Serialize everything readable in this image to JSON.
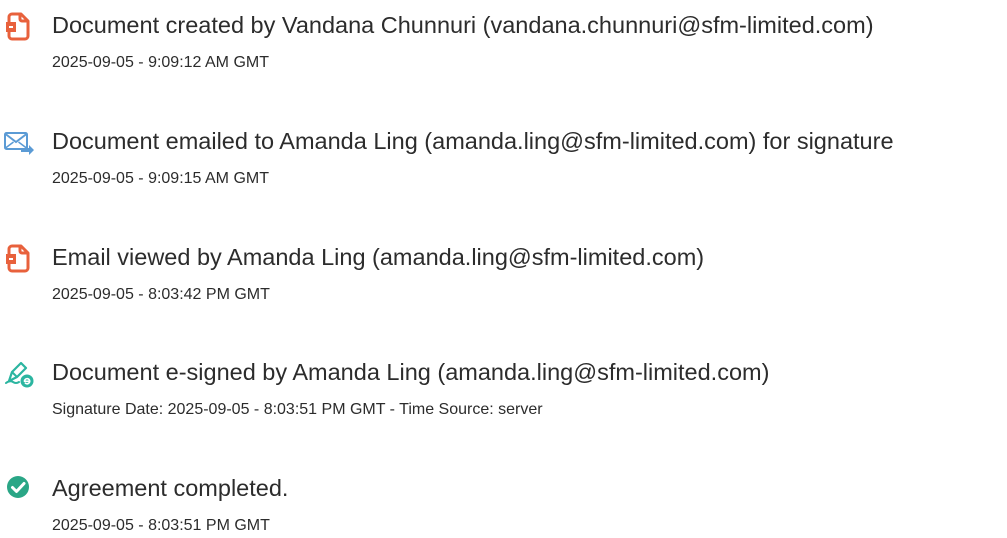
{
  "audit_events": [
    {
      "icon": "document-icon",
      "title": "Document created by Vandana Chunnuri (vandana.chunnuri@sfm-limited.com)",
      "timestamp": "2025-09-05 - 9:09:12 AM GMT"
    },
    {
      "icon": "email-sent-icon",
      "title": "Document emailed to Amanda Ling (amanda.ling@sfm-limited.com) for signature",
      "timestamp": "2025-09-05 - 9:09:15 AM GMT"
    },
    {
      "icon": "document-icon",
      "title": "Email viewed by Amanda Ling (amanda.ling@sfm-limited.com)",
      "timestamp": "2025-09-05 - 8:03:42 PM GMT"
    },
    {
      "icon": "e-sign-pen-icon",
      "title": "Document e-signed by Amanda Ling (amanda.ling@sfm-limited.com)",
      "timestamp": "Signature Date: 2025-09-05 - 8:03:51 PM GMT - Time Source: server"
    },
    {
      "icon": "check-circle-icon",
      "title": "Agreement completed.",
      "timestamp": "2025-09-05 - 8:03:51 PM GMT"
    }
  ],
  "colors": {
    "document_icon": "#e8613c",
    "email_icon": "#5b9bd5",
    "pen_icon": "#2bb5a0",
    "check_icon": "#2aa686",
    "text": "#2c2c2c"
  }
}
